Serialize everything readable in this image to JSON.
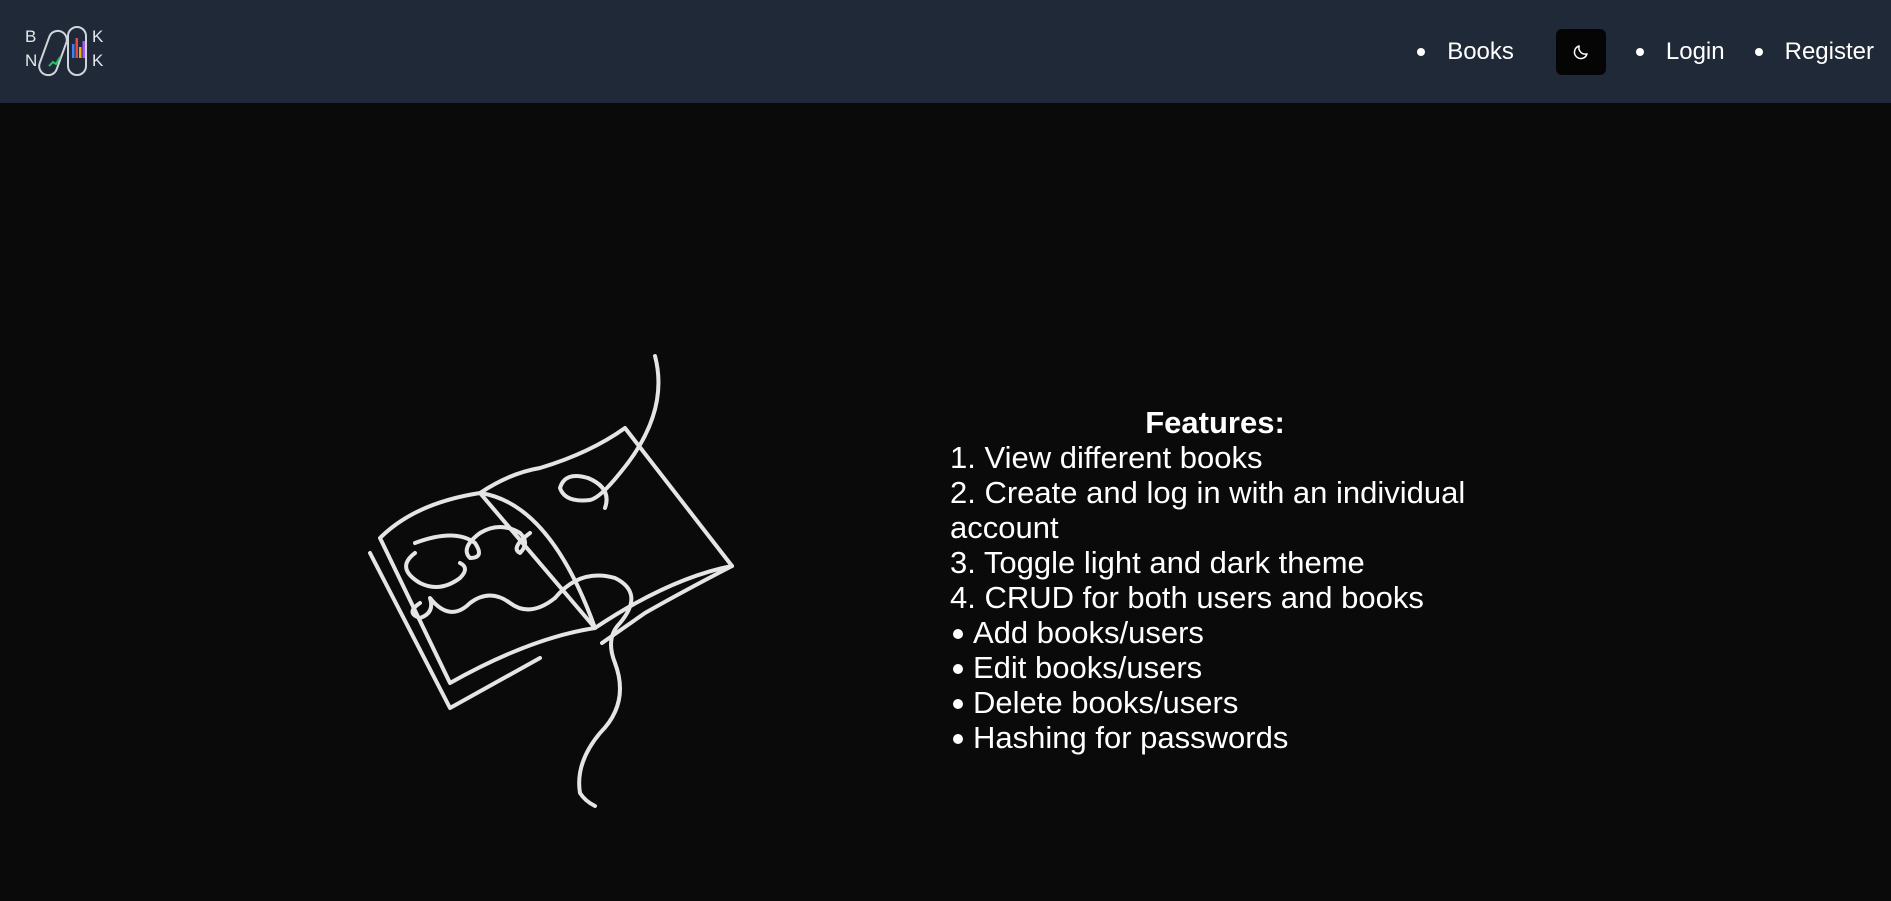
{
  "header": {
    "logo": {
      "letters": [
        "B",
        "N",
        "K",
        "K"
      ],
      "icon": "book-logo-icon",
      "accent_colors": [
        "#22c55e",
        "#3b82f6",
        "#ef4444",
        "#eab308",
        "#a855f7"
      ]
    },
    "nav": {
      "books_label": "Books",
      "theme_toggle_icon": "moon-icon",
      "login_label": "Login",
      "register_label": "Register"
    }
  },
  "main": {
    "illustration_icon": "open-book-line-art-icon",
    "features": {
      "title": "Features:",
      "numbered": [
        "1. View different books",
        "2. Create and log in with an individual account",
        "3. Toggle light and dark theme",
        "4. CRUD for both users and books"
      ],
      "bulleted": [
        "Add books/users",
        "Edit books/users",
        "Delete books/users",
        "Hashing for passwords"
      ]
    }
  },
  "colors": {
    "navbar_bg": "#1f2937",
    "page_bg": "#0a0a0a",
    "text": "#ffffff",
    "toggle_bg": "#050505"
  }
}
